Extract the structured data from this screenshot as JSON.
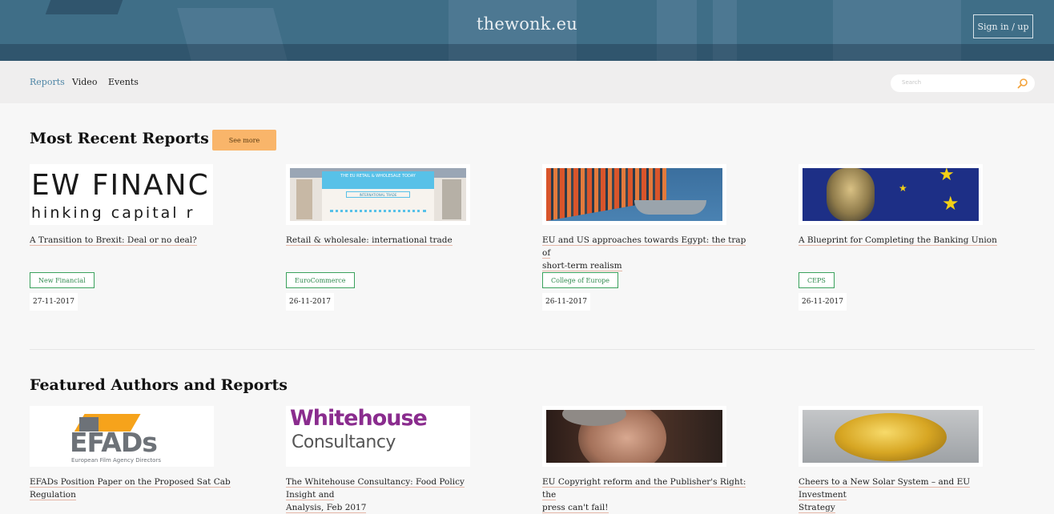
{
  "header": {
    "logo": "thewonk.eu",
    "signin_label": "Sign in / up"
  },
  "nav": {
    "items": [
      {
        "label": "Reports",
        "active": true
      },
      {
        "label": "Video",
        "active": false
      },
      {
        "label": "Events",
        "active": false
      }
    ],
    "search_placeholder": "Search"
  },
  "recent": {
    "title": "Most Recent Reports",
    "see_more": "See more",
    "cards": [
      {
        "thumb_text_1": "EW FINANC",
        "thumb_text_2": "hinking capital r",
        "title": "A Transition to Brexit: Deal or no deal?",
        "tag": "New Financial",
        "date": "27-11-2017"
      },
      {
        "thumb_text_1": "THE EU RETAIL & WHOLESALE TODAY",
        "thumb_text_2": "INTERNATIONAL TRADE",
        "title": "Retail & wholesale: international trade",
        "tag": "EuroCommerce",
        "date": "26-11-2017"
      },
      {
        "title_line1": "EU and US approaches towards Egypt: the trap of",
        "title_line2": "short-term realism",
        "tag": "College of Europe",
        "date": "26-11-2017"
      },
      {
        "title": "A Blueprint for Completing the Banking Union",
        "tag": "CEPS",
        "date": "26-11-2017"
      }
    ]
  },
  "featured": {
    "title": "Featured Authors and Reports",
    "cards": [
      {
        "logo_text": "EFADs",
        "logo_sub": "European Film Agency Directors",
        "title_line1": "EFADs Position Paper on the Proposed Sat Cab",
        "title_line2": "Regulation"
      },
      {
        "logo_text_1": "Whitehouse",
        "logo_text_2": "Consultancy",
        "title_line1": "The Whitehouse Consultancy: Food Policy Insight and",
        "title_line2": "Analysis, Feb 2017"
      },
      {
        "title_line1": "EU Copyright reform and the Publisher's Right: the",
        "title_line2": "press can't fail!"
      },
      {
        "title_line1": "Cheers to a New Solar System – and EU Investment",
        "title_line2": "Strategy"
      }
    ]
  },
  "colors": {
    "header": "#3f6e87",
    "accent": "#4f86a6",
    "button": "#f9b56a",
    "tag": "#3aa15c"
  }
}
